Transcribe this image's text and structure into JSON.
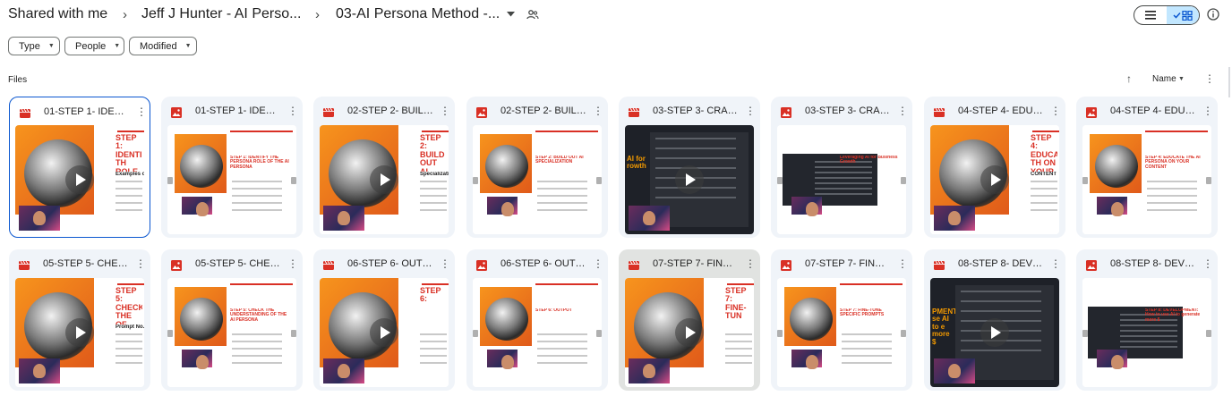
{
  "breadcrumb": {
    "root": "Shared with me",
    "parent": "Jeff J Hunter - AI Perso...",
    "current": "03-AI Persona Method -..."
  },
  "filters": [
    {
      "label": "Type"
    },
    {
      "label": "People"
    },
    {
      "label": "Modified"
    }
  ],
  "section_label": "Files",
  "sort": {
    "label": "Name",
    "direction": "ascending"
  },
  "colors": {
    "video": "#d93025",
    "image": "#d93025",
    "accent": "#0b57d0",
    "toggle_active": "#c2e7ff"
  },
  "files": [
    {
      "title": "01-STEP 1- IDENTI...",
      "kind": "video",
      "thumb_heading": "STEP 1: IDENTIFY TH ROLE OF TH",
      "thumb_sub": "Examples of A"
    },
    {
      "title": "01-STEP 1- IDENTI...",
      "kind": "image",
      "thumb_heading": "STEP 1: IDENTIFY THE PERSONA ROLE OF THE AI PERSONA",
      "thumb_sub": ""
    },
    {
      "title": "02-STEP 2- BUILD ...",
      "kind": "video",
      "thumb_heading": "STEP 2: BUILD OUT AI SPECIAL",
      "thumb_sub": "Specializatio"
    },
    {
      "title": "02-STEP 2- BUILD ...",
      "kind": "image",
      "thumb_heading": "STEP 2: BUILD OUT AI SPECIALIZATION",
      "thumb_sub": ""
    },
    {
      "title": "03-STEP 3- CRAFT...",
      "kind": "video",
      "thumb_heading": "AI for rowth",
      "thumb_sub": ""
    },
    {
      "title": "03-STEP 3- CRAFT...",
      "kind": "image",
      "thumb_heading": "Leveraging AI for Business Growth",
      "thumb_sub": ""
    },
    {
      "title": "04-STEP 4- EDUC...",
      "kind": "video",
      "thumb_heading": "STEP 4: EDUCATE TH ON YOUR CO",
      "thumb_sub": "CONTENT"
    },
    {
      "title": "04-STEP 4- EDUC...",
      "kind": "image",
      "thumb_heading": "STEP 4: EDUCATE THE AI PERSONA ON YOUR CONTENT",
      "thumb_sub": ""
    },
    {
      "title": "05-STEP 5- CHEC...",
      "kind": "video",
      "thumb_heading": "STEP 5: CHECK THE OF THE AI P",
      "thumb_sub": "Prompt No.1"
    },
    {
      "title": "05-STEP 5- CHEC...",
      "kind": "image",
      "thumb_heading": "STEP 5: CHECK THE UNDERSTANDING OF THE AI PERSONA",
      "thumb_sub": ""
    },
    {
      "title": "06-STEP 6- OUTP...",
      "kind": "video",
      "thumb_heading": "STEP 6:",
      "thumb_sub": ""
    },
    {
      "title": "06-STEP 6- OUTP...",
      "kind": "image",
      "thumb_heading": "STEP 6: OUTPUT",
      "thumb_sub": ""
    },
    {
      "title": "07-STEP 7- FINE-T...",
      "kind": "video",
      "thumb_heading": "STEP 7: FINE-TUN",
      "thumb_sub": ""
    },
    {
      "title": "07-STEP 7- FINE-T...",
      "kind": "image",
      "thumb_heading": "STEP 7: FINE-TUNE SPECIFIC PROMPTS",
      "thumb_sub": ""
    },
    {
      "title": "08-STEP 8- DEVEL...",
      "kind": "video",
      "thumb_heading": "PMENT: se AI to e more $",
      "thumb_sub": ""
    },
    {
      "title": "08-STEP 8- DEVEL...",
      "kind": "image",
      "thumb_heading": "STEP 8: DEVELOPMENT: How to use AI to generate more $",
      "thumb_sub": ""
    }
  ]
}
